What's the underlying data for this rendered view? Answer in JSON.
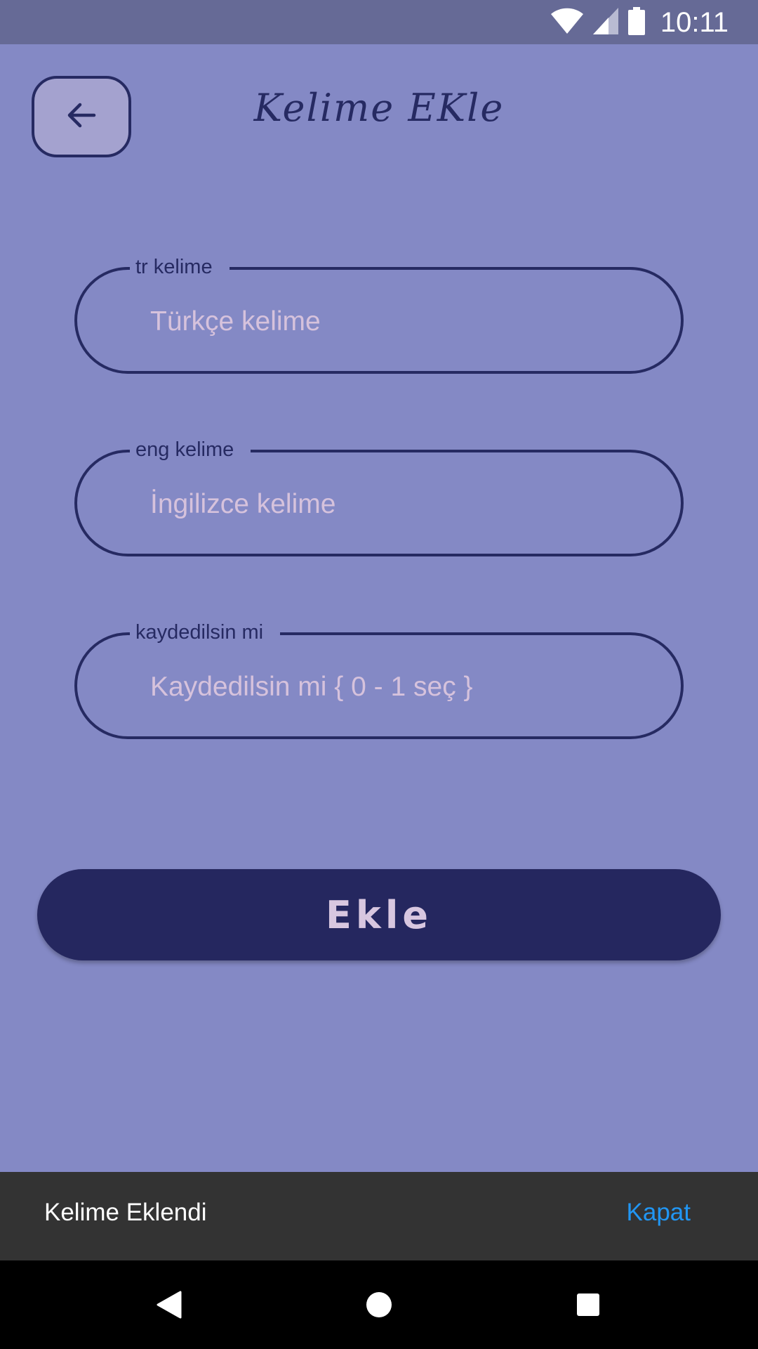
{
  "status_bar": {
    "time": "10:11",
    "icons": [
      "wifi-icon",
      "cell-signal-icon",
      "battery-icon"
    ]
  },
  "header": {
    "title": "Kelime EKle",
    "back_icon": "arrow-left-icon"
  },
  "form": {
    "fields": [
      {
        "label": "tr kelime",
        "placeholder": "Türkçe kelime",
        "value": ""
      },
      {
        "label": "eng kelime",
        "placeholder": "İngilizce kelime",
        "value": ""
      },
      {
        "label": "kaydedilsin mi",
        "placeholder": "Kaydedilsin mi { 0 - 1 seç }",
        "value": ""
      }
    ],
    "submit_label": "Ekle"
  },
  "snackbar": {
    "message": "Kelime Eklendi",
    "action": "Kapat"
  },
  "nav_bar": {
    "icons": [
      "back-triangle-icon",
      "home-circle-icon",
      "recents-square-icon"
    ]
  },
  "colors": {
    "background": "#8489c5",
    "status_bar": "#666a96",
    "accent_dark": "#262a62",
    "button": "#25275f",
    "placeholder": "#d6c2dc",
    "snackbar": "#333333",
    "snackbar_action": "#2196f3"
  }
}
